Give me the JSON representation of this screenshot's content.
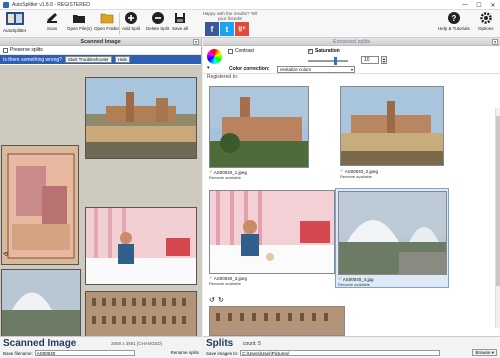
{
  "window": {
    "title": "AutoSplitter v1.8.8 - REGISTERED",
    "controls": [
      "—",
      "☐",
      "✕"
    ]
  },
  "toolbar": {
    "logo_label": "AutoSplitter",
    "scan_label": "Scan",
    "open_label": "Open File(s)",
    "open_folder_label": "Open Folder",
    "add_split_label": "Add Split",
    "delete_split_label": "Delete Split",
    "save_all_label": "Save all",
    "happy_text": "Happy with the results? Tell your friends!",
    "social": [
      "f",
      "t",
      "g+"
    ],
    "help_label": "Help & Tutorials",
    "options_label": "Options"
  },
  "left": {
    "header": "Scanned Image",
    "help": "?",
    "preserve_splits": "Preserve splits",
    "wrong_text": "Is there something wrong?",
    "troubleshooter_btn": "Start Troubleshooter",
    "hide_btn": "Hide",
    "footer_title": "Scanned Image",
    "footer_info": "2568 x 3581 [CHANGED]",
    "base_filename_label": "Base filename:",
    "base_filename_value": "AS00040",
    "rename_label": "Rename splits"
  },
  "right": {
    "header": "Extracted splits",
    "help": "?",
    "contrast_label": "Contrast",
    "saturation_label": "Saturation",
    "saturation_value": "10",
    "color_correction_label": "Color correction:",
    "color_correction_value": "revitalize colors",
    "registered_to": "Registered to:",
    "tiles": [
      {
        "name": "AS00040_1.jpeg",
        "rename": "Rename available"
      },
      {
        "name": "AS00040_2.jpeg",
        "rename": "Rename available"
      },
      {
        "name": "AS00040_3.jpeg",
        "rename": "Rename available"
      },
      {
        "name": "AS00040_4.jpg",
        "rename": "Rename available"
      }
    ],
    "footer_title": "Splits",
    "footer_count": "count: 5",
    "save_label": "Save images to:",
    "save_path": "C:\\Users\\User\\Pictures\\",
    "browse_label": "Browse ▾"
  },
  "colors": {
    "accent": "#2f5fb3",
    "facebook": "#3b5998",
    "twitter": "#1da1f2",
    "google": "#dd4b39",
    "ok": "#1c8d2e"
  }
}
